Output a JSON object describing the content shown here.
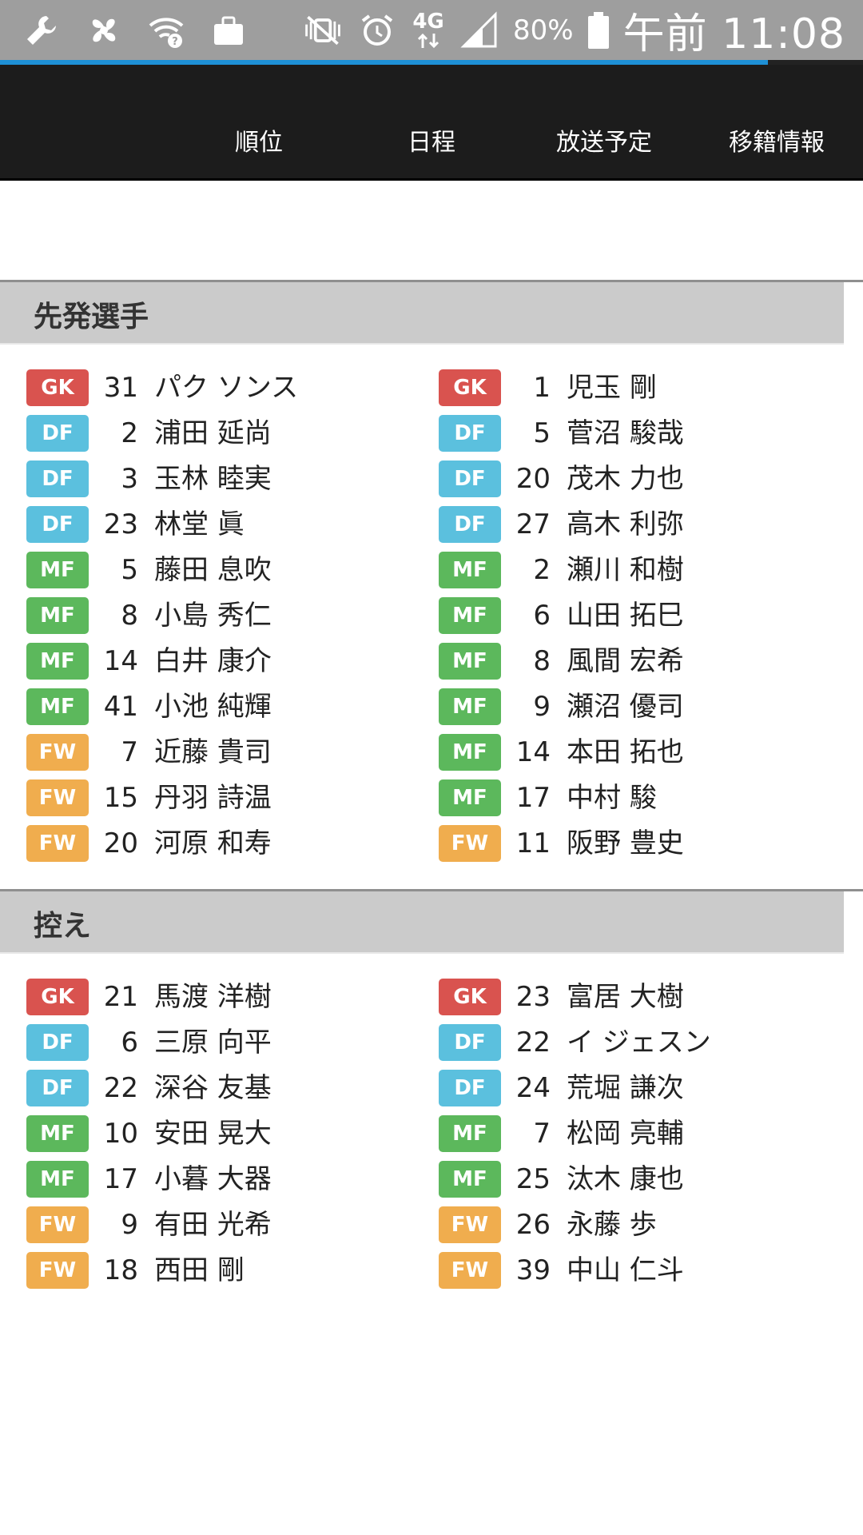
{
  "status_bar": {
    "left_icons": [
      "wrench-icon",
      "bluetooth-icon",
      "wifi-question-icon",
      "briefcase-icon"
    ],
    "right_icons": [
      "mute-vibrate-icon",
      "alarm-icon",
      "network-4g-icon",
      "signal-icon"
    ],
    "network": "4G",
    "battery": "80%",
    "time": "午前 11:08"
  },
  "progress": {
    "fraction": 0.89,
    "color": "#1e90d6"
  },
  "nav": {
    "items": [
      "順位",
      "日程",
      "放送予定",
      "移籍情報"
    ]
  },
  "position_colors": {
    "GK": "#d9534f",
    "DF": "#5bc0de",
    "MF": "#5cb85c",
    "FW": "#f0ad4e"
  },
  "starters": {
    "title": "先発選手",
    "left": [
      {
        "pos": "GK",
        "num": "31",
        "name": "パク ソンス"
      },
      {
        "pos": "DF",
        "num": "2",
        "name": "浦田 延尚"
      },
      {
        "pos": "DF",
        "num": "3",
        "name": "玉林 睦実"
      },
      {
        "pos": "DF",
        "num": "23",
        "name": "林堂 眞"
      },
      {
        "pos": "MF",
        "num": "5",
        "name": "藤田 息吹"
      },
      {
        "pos": "MF",
        "num": "8",
        "name": "小島 秀仁"
      },
      {
        "pos": "MF",
        "num": "14",
        "name": "白井 康介"
      },
      {
        "pos": "MF",
        "num": "41",
        "name": "小池 純輝"
      },
      {
        "pos": "FW",
        "num": "7",
        "name": "近藤 貴司"
      },
      {
        "pos": "FW",
        "num": "15",
        "name": "丹羽 詩温"
      },
      {
        "pos": "FW",
        "num": "20",
        "name": "河原 和寿"
      }
    ],
    "right": [
      {
        "pos": "GK",
        "num": "1",
        "name": "児玉 剛"
      },
      {
        "pos": "DF",
        "num": "5",
        "name": "菅沼 駿哉"
      },
      {
        "pos": "DF",
        "num": "20",
        "name": "茂木 力也"
      },
      {
        "pos": "DF",
        "num": "27",
        "name": "高木 利弥"
      },
      {
        "pos": "MF",
        "num": "2",
        "name": "瀬川 和樹"
      },
      {
        "pos": "MF",
        "num": "6",
        "name": "山田 拓巳"
      },
      {
        "pos": "MF",
        "num": "8",
        "name": "風間 宏希"
      },
      {
        "pos": "MF",
        "num": "9",
        "name": "瀬沼 優司"
      },
      {
        "pos": "MF",
        "num": "14",
        "name": "本田 拓也"
      },
      {
        "pos": "MF",
        "num": "17",
        "name": "中村 駿"
      },
      {
        "pos": "FW",
        "num": "11",
        "name": "阪野 豊史"
      }
    ]
  },
  "substitutes": {
    "title": "控え",
    "left": [
      {
        "pos": "GK",
        "num": "21",
        "name": "馬渡 洋樹"
      },
      {
        "pos": "DF",
        "num": "6",
        "name": "三原 向平"
      },
      {
        "pos": "DF",
        "num": "22",
        "name": "深谷 友基"
      },
      {
        "pos": "MF",
        "num": "10",
        "name": "安田 晃大"
      },
      {
        "pos": "MF",
        "num": "17",
        "name": "小暮 大器"
      },
      {
        "pos": "FW",
        "num": "9",
        "name": "有田 光希"
      },
      {
        "pos": "FW",
        "num": "18",
        "name": "西田 剛"
      }
    ],
    "right": [
      {
        "pos": "GK",
        "num": "23",
        "name": "富居 大樹"
      },
      {
        "pos": "DF",
        "num": "22",
        "name": "イ ジェスン"
      },
      {
        "pos": "DF",
        "num": "24",
        "name": "荒堀 謙次"
      },
      {
        "pos": "MF",
        "num": "7",
        "name": "松岡 亮輔"
      },
      {
        "pos": "MF",
        "num": "25",
        "name": "汰木 康也"
      },
      {
        "pos": "FW",
        "num": "26",
        "name": "永藤 歩"
      },
      {
        "pos": "FW",
        "num": "39",
        "name": "中山 仁斗"
      }
    ]
  }
}
